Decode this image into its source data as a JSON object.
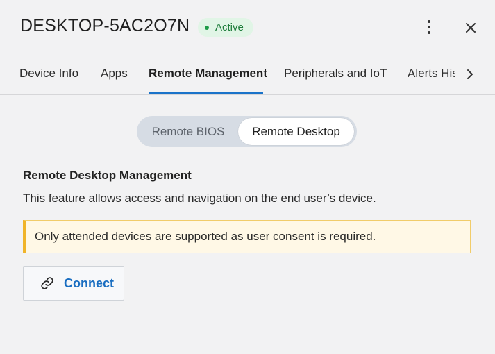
{
  "header": {
    "device_name": "DESKTOP-5AC2O7N",
    "status_label": "Active",
    "status_color": "#1e9c48"
  },
  "tabs": [
    {
      "label": "Device Info",
      "active": false
    },
    {
      "label": "Apps",
      "active": false
    },
    {
      "label": "Remote Management",
      "active": true
    },
    {
      "label": "Peripherals and IoT",
      "active": false
    },
    {
      "label": "Alerts History",
      "active": false
    }
  ],
  "segmented": {
    "options": [
      "Remote BIOS",
      "Remote Desktop"
    ],
    "selected": "Remote Desktop"
  },
  "remote_desktop": {
    "title": "Remote Desktop Management",
    "description": "This feature allows access and navigation on the end user’s device.",
    "notice": "Only attended devices are supported as user consent is required.",
    "connect_label": "Connect"
  },
  "icons": {
    "more": "kebab-menu-icon",
    "close": "close-icon",
    "tabs_next": "chevron-right-icon",
    "connect": "link-icon"
  },
  "colors": {
    "accent": "#1a73c9",
    "link": "#1a6ec1",
    "notice_border": "#f0b429",
    "notice_bg": "#fff8e6"
  }
}
